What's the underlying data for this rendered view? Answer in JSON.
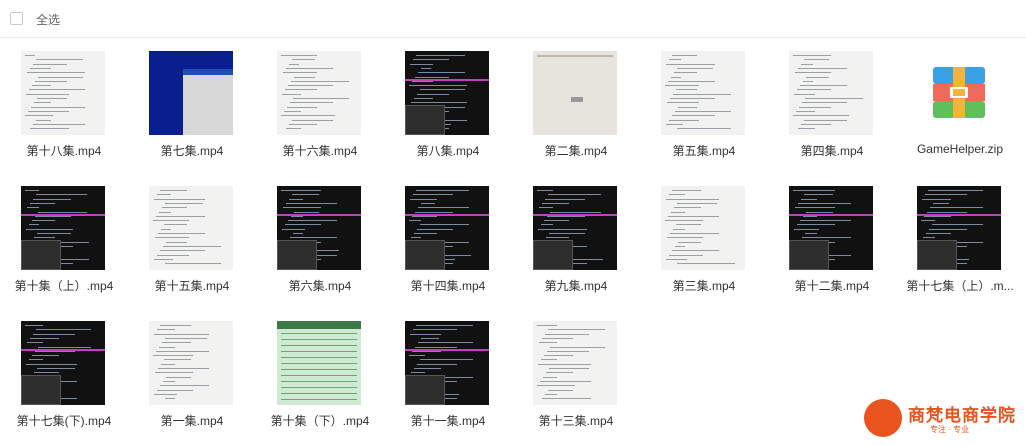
{
  "toolbar": {
    "select_all_label": "全选"
  },
  "files": [
    {
      "name": "第十八集.mp4",
      "thumb": "code"
    },
    {
      "name": "第七集.mp4",
      "thumb": "blue"
    },
    {
      "name": "第十六集.mp4",
      "thumb": "code"
    },
    {
      "name": "第八集.mp4",
      "thumb": "dark"
    },
    {
      "name": "第二集.mp4",
      "thumb": "gray"
    },
    {
      "name": "第五集.mp4",
      "thumb": "code"
    },
    {
      "name": "第四集.mp4",
      "thumb": "code"
    },
    {
      "name": "GameHelper.zip",
      "thumb": "zip"
    },
    {
      "name": "第十集（上）.mp4",
      "thumb": "dark"
    },
    {
      "name": "第十五集.mp4",
      "thumb": "code"
    },
    {
      "name": "第六集.mp4",
      "thumb": "dark"
    },
    {
      "name": "第十四集.mp4",
      "thumb": "dark"
    },
    {
      "name": "第九集.mp4",
      "thumb": "dark"
    },
    {
      "name": "第三集.mp4",
      "thumb": "code"
    },
    {
      "name": "第十二集.mp4",
      "thumb": "dark"
    },
    {
      "name": "第十七集（上）.m...",
      "thumb": "dark"
    },
    {
      "name": "第十七集(下).mp4",
      "thumb": "dark"
    },
    {
      "name": "第一集.mp4",
      "thumb": "code"
    },
    {
      "name": "第十集（下）.mp4",
      "thumb": "green"
    },
    {
      "name": "第十一集.mp4",
      "thumb": "dark"
    },
    {
      "name": "第十三集.mp4",
      "thumb": "code"
    }
  ],
  "watermark": {
    "title": "商梵电商学院",
    "subtitle": "专注 · 专业"
  }
}
